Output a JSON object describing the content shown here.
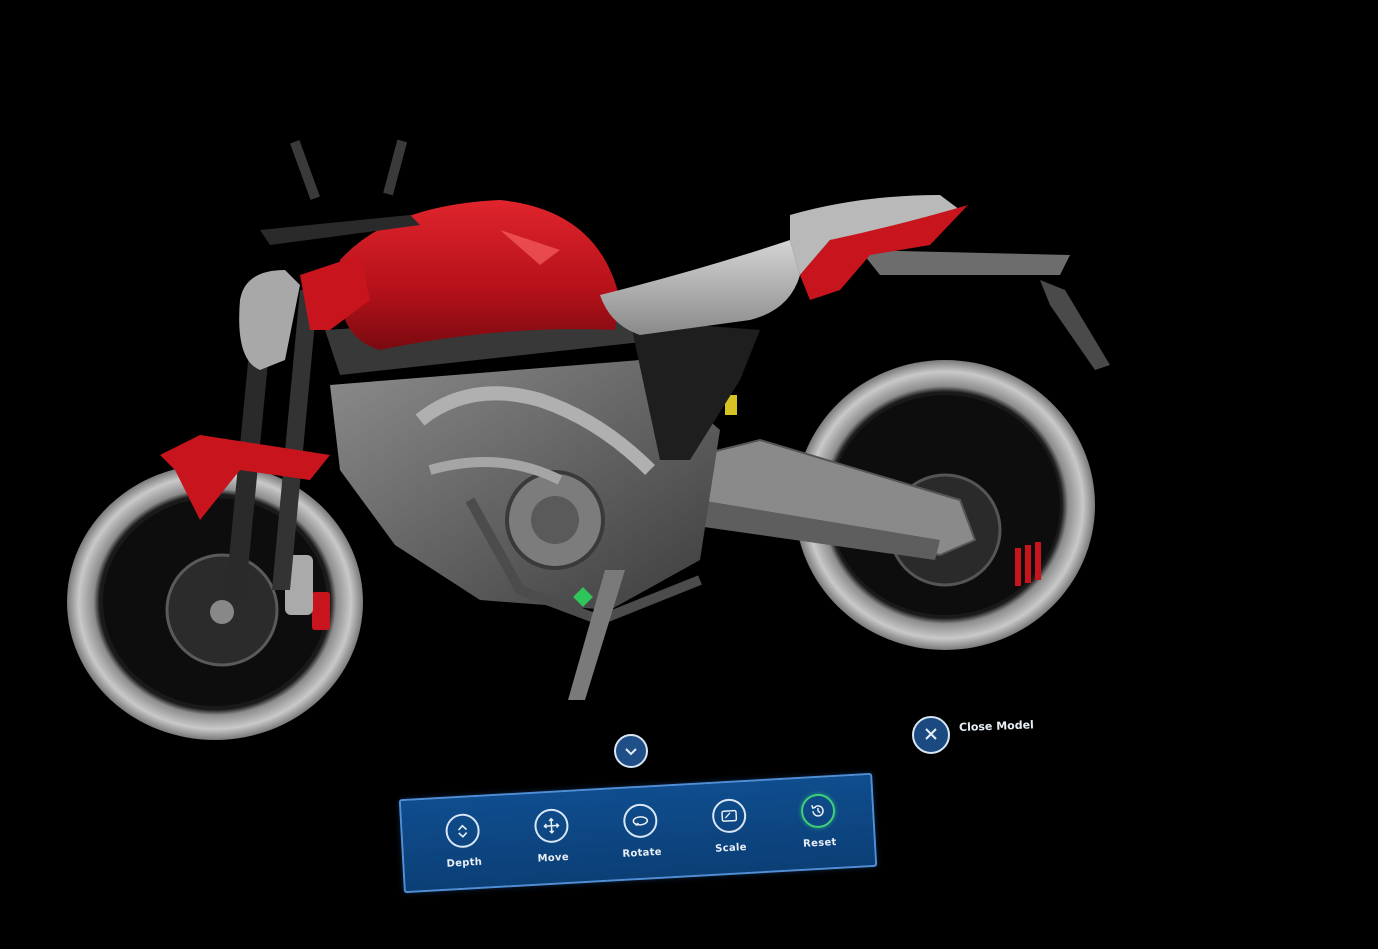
{
  "scene": {
    "model_name": "motorcycle-3d-model"
  },
  "close_model": {
    "label": "Close Model",
    "icon": "close-icon"
  },
  "collapse": {
    "icon": "chevron-down-icon"
  },
  "toolbar": {
    "tools": [
      {
        "label": "Depth",
        "icon": "depth-icon"
      },
      {
        "label": "Move",
        "icon": "move-icon"
      },
      {
        "label": "Rotate",
        "icon": "rotate-icon"
      },
      {
        "label": "Scale",
        "icon": "scale-icon"
      },
      {
        "label": "Reset",
        "icon": "reset-icon",
        "active_color": "#3fd17a"
      }
    ]
  },
  "colors": {
    "panel": "#0f4d8e",
    "panel_border": "#4f8fd8",
    "bike_red": "#c8141c",
    "bike_grey": "#9a9a9a",
    "accent_green": "#3fd17a"
  }
}
